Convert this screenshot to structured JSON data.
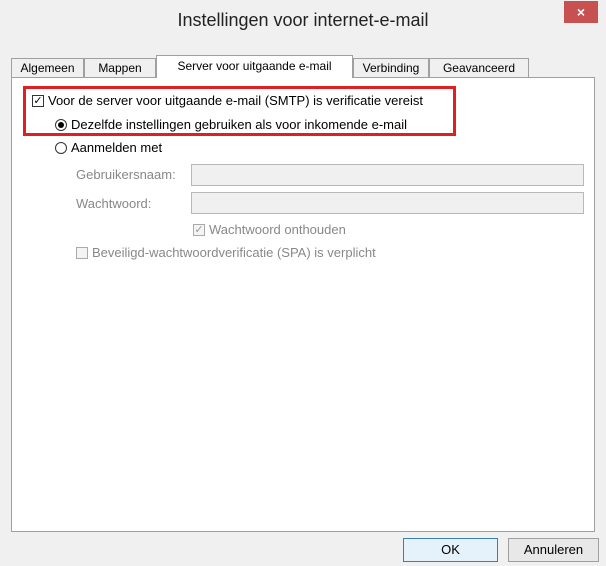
{
  "window": {
    "title": "Instellingen voor internet-e-mail",
    "close_label": "×"
  },
  "tabs": [
    {
      "label": "Algemeen"
    },
    {
      "label": "Mappen"
    },
    {
      "label": "Server voor uitgaande e-mail",
      "active": true
    },
    {
      "label": "Verbinding"
    },
    {
      "label": "Geavanceerd"
    }
  ],
  "smtp": {
    "auth_required_label": "Voor de server voor uitgaande e-mail (SMTP) is verificatie vereist",
    "auth_required_checked": true,
    "same_settings_label": "Dezelfde instellingen gebruiken als voor inkomende e-mail",
    "same_settings_selected": true,
    "login_with_label": "Aanmelden met",
    "username_label": "Gebruikersnaam:",
    "username_value": "",
    "password_label": "Wachtwoord:",
    "password_value": "",
    "remember_password_label": "Wachtwoord onthouden",
    "remember_password_checked": true,
    "spa_label": "Beveiligd-wachtwoordverificatie (SPA) is verplicht",
    "spa_checked": false
  },
  "buttons": {
    "ok": "OK",
    "cancel": "Annuleren"
  },
  "colors": {
    "highlight": "#e02020",
    "close": "#c75050"
  }
}
